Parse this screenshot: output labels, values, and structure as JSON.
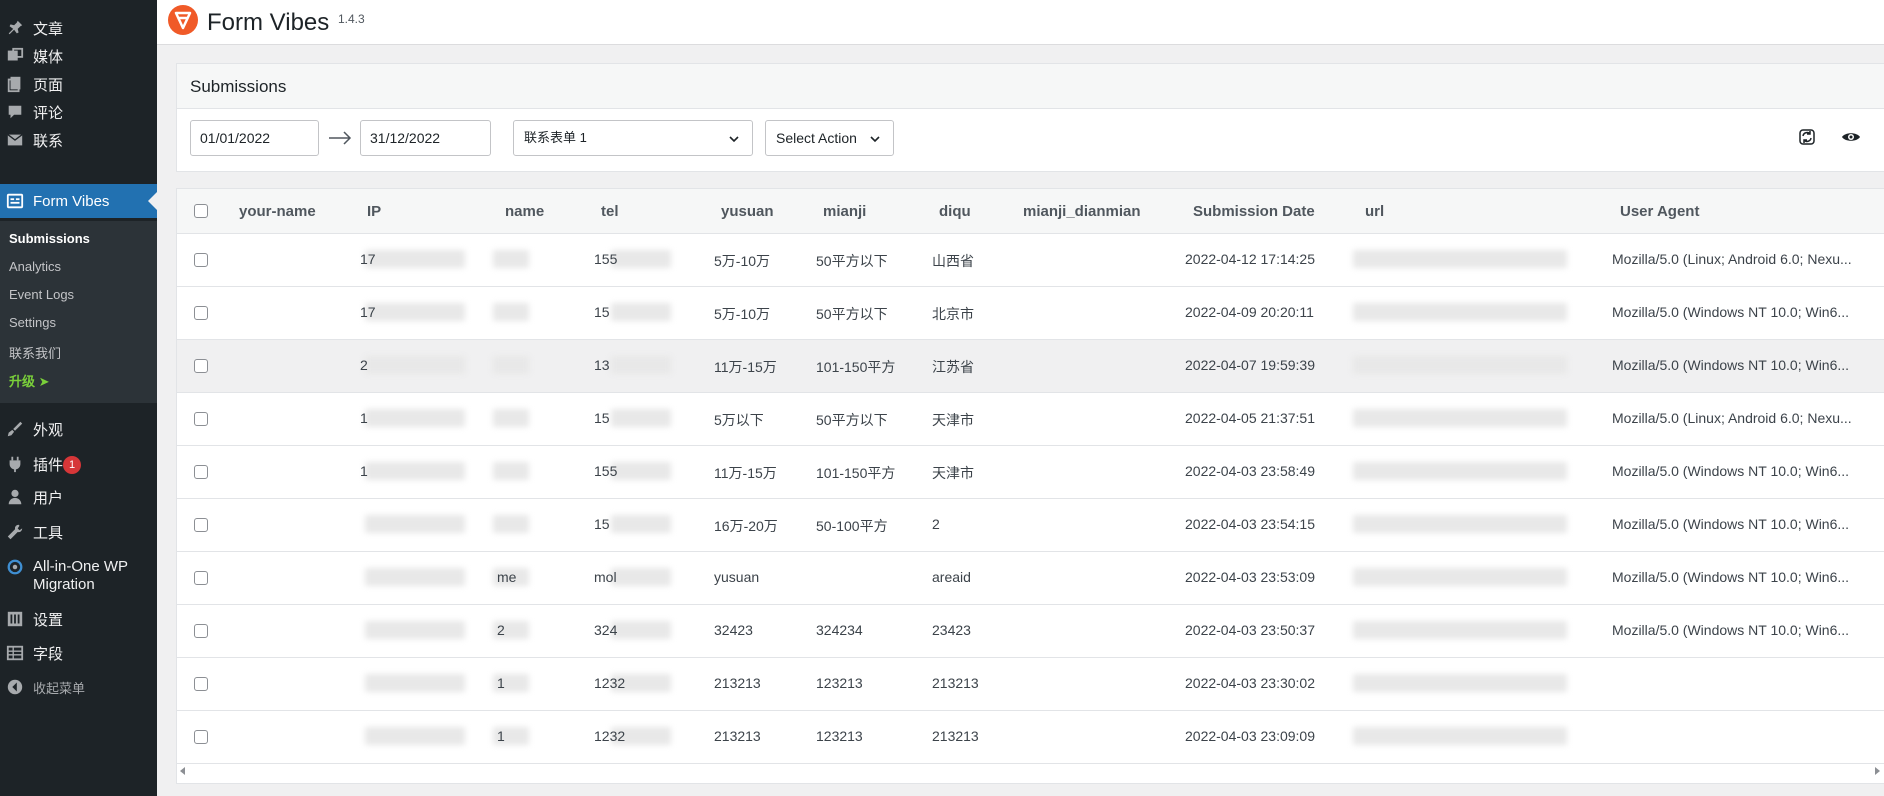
{
  "sidebar": {
    "items": [
      {
        "label": "文章",
        "icon": "pushpin-icon"
      },
      {
        "label": "媒体",
        "icon": "media-icon"
      },
      {
        "label": "页面",
        "icon": "pages-icon"
      },
      {
        "label": "评论",
        "icon": "comment-icon"
      },
      {
        "label": "联系",
        "icon": "mail-icon"
      },
      {
        "label": "Form Vibes",
        "icon": "form-icon"
      },
      {
        "label": "外观",
        "icon": "brush-icon"
      },
      {
        "label": "插件",
        "icon": "plugin-icon",
        "badge": "1"
      },
      {
        "label": "用户",
        "icon": "user-icon"
      },
      {
        "label": "工具",
        "icon": "wrench-icon"
      },
      {
        "label": "All-in-One WP",
        "label2": "Migration",
        "icon": "migration-icon"
      },
      {
        "label": "设置",
        "icon": "settings-icon"
      },
      {
        "label": "字段",
        "icon": "table-icon"
      },
      {
        "label": "收起菜单",
        "icon": "collapse-icon"
      }
    ],
    "submenu": [
      "Submissions",
      "Analytics",
      "Event Logs",
      "Settings",
      "联系我们",
      "升级 ➤"
    ]
  },
  "header": {
    "title": "Form Vibes",
    "version": "1.4.3"
  },
  "card": {
    "title": "Submissions",
    "date_from": "01/01/2022",
    "date_to": "31/12/2022",
    "form_select": "联系表单 1",
    "action_select": "Select Action"
  },
  "table": {
    "columns": [
      "your-name",
      "IP",
      "name",
      "tel",
      "yusuan",
      "mianji",
      "diqu",
      "mianji_dianmian",
      "Submission Date",
      "url",
      "User Agent"
    ],
    "rows": [
      {
        "ip": "17",
        "name": "",
        "tel": "155",
        "yusuan": "5万-10万",
        "mianji": "50平方以下",
        "diqu": "山西省",
        "date": "2022-04-12 17:14:25",
        "ua": "Mozilla/5.0 (Linux; Android 6.0; Nexu..."
      },
      {
        "ip": "17",
        "name": "",
        "tel": "15",
        "yusuan": "5万-10万",
        "mianji": "50平方以下",
        "diqu": "北京市",
        "date": "2022-04-09 20:20:11",
        "ua": "Mozilla/5.0 (Windows NT 10.0; Win6..."
      },
      {
        "ip": "2",
        "name": "",
        "tel": "13",
        "yusuan": "11万-15万",
        "mianji": "101-150平方",
        "diqu": "江苏省",
        "date": "2022-04-07 19:59:39",
        "ua": "Mozilla/5.0 (Windows NT 10.0; Win6..."
      },
      {
        "ip": "1",
        "name": "",
        "tel": "15",
        "yusuan": "5万以下",
        "mianji": "50平方以下",
        "diqu": "天津市",
        "date": "2022-04-05 21:37:51",
        "ua": "Mozilla/5.0 (Linux; Android 6.0; Nexu..."
      },
      {
        "ip": "1",
        "name": "",
        "tel": "155",
        "yusuan": "11万-15万",
        "mianji": "101-150平方",
        "diqu": "天津市",
        "date": "2022-04-03 23:58:49",
        "ua": "Mozilla/5.0 (Windows NT 10.0; Win6..."
      },
      {
        "ip": "",
        "name": "",
        "tel": "15",
        "yusuan": "16万-20万",
        "mianji": "50-100平方",
        "diqu": "2",
        "date": "2022-04-03 23:54:15",
        "ua": "Mozilla/5.0 (Windows NT 10.0; Win6..."
      },
      {
        "ip": "",
        "name": "me",
        "tel": "mol",
        "yusuan": "yusuan",
        "mianji": "",
        "diqu": "areaid",
        "date": "2022-04-03 23:53:09",
        "ua": "Mozilla/5.0 (Windows NT 10.0; Win6..."
      },
      {
        "ip": "",
        "name": "2",
        "tel": "324",
        "yusuan": "32423",
        "mianji": "324234",
        "diqu": "23423",
        "date": "2022-04-03 23:50:37",
        "ua": "Mozilla/5.0 (Windows NT 10.0; Win6..."
      },
      {
        "ip": "",
        "name": "1",
        "tel": "1232",
        "yusuan": "213213",
        "mianji": "123213",
        "diqu": "213213",
        "date": "2022-04-03 23:30:02",
        "ua": ""
      },
      {
        "ip": "",
        "name": "1",
        "tel": "1232",
        "yusuan": "213213",
        "mianji": "123213",
        "diqu": "213213",
        "date": "2022-04-03 23:09:09",
        "ua": ""
      }
    ]
  },
  "colors": {
    "sidebar": "#1d2327",
    "accent": "#2271b1",
    "logo": "#f05a28",
    "upgrade": "#7ad03a"
  }
}
